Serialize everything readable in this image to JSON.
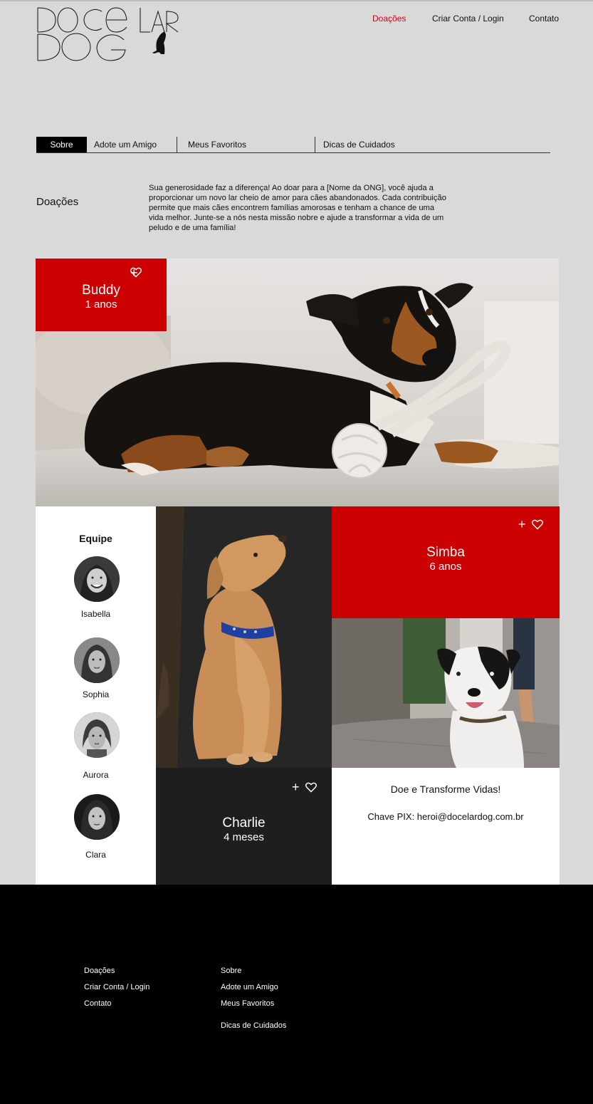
{
  "brand": {
    "logo_text": "DOCE LAR DOG"
  },
  "topnav": {
    "items": [
      {
        "label": "Doações",
        "active": true
      },
      {
        "label": "Criar Conta / Login"
      },
      {
        "label": "Contato"
      }
    ]
  },
  "tabs": [
    {
      "label": "Sobre",
      "active": true
    },
    {
      "label": "Adote um Amigo"
    },
    {
      "label": "Meus Favoritos"
    },
    {
      "label": "Dicas de Cuidados"
    }
  ],
  "intro": {
    "title": "Doações",
    "text": "Sua generosidade faz a diferença! Ao doar para a [Nome da ONG], você ajuda a proporcionar um novo lar cheio de amor para cães abandonados. Cada contribuição permite que mais cães encontrem famílias amorosas e tenham a chance de uma vida melhor. Junte-se a nós nesta missão nobre e ajude a transformar a vida de um peludo e de uma família!"
  },
  "pets": {
    "buddy": {
      "name": "Buddy",
      "age": "1 anos"
    },
    "simba": {
      "name": "Simba",
      "age": "6 anos"
    },
    "charlie": {
      "name": "Charlie",
      "age": "4 meses"
    },
    "add_symbol": "+"
  },
  "team": {
    "title": "Equipe",
    "members": [
      {
        "name": "Isabella"
      },
      {
        "name": "Sophia"
      },
      {
        "name": "Aurora"
      },
      {
        "name": "Clara"
      }
    ]
  },
  "donate": {
    "title": "Doe e Transforme Vidas!",
    "pix": "Chave PIX: heroi@docelardog.com.br"
  },
  "footer": {
    "col1": [
      "Doações",
      "Criar Conta / Login",
      "Contato"
    ],
    "col2": [
      "Sobre",
      "Adote um Amigo",
      "Meus Favoritos",
      "Dicas de Cuidados"
    ]
  },
  "colors": {
    "accent": "#cc0000",
    "dark": "#1e1e1e",
    "background": "#d9d9d9"
  },
  "icons": [
    "plus-icon",
    "heart-icon"
  ]
}
